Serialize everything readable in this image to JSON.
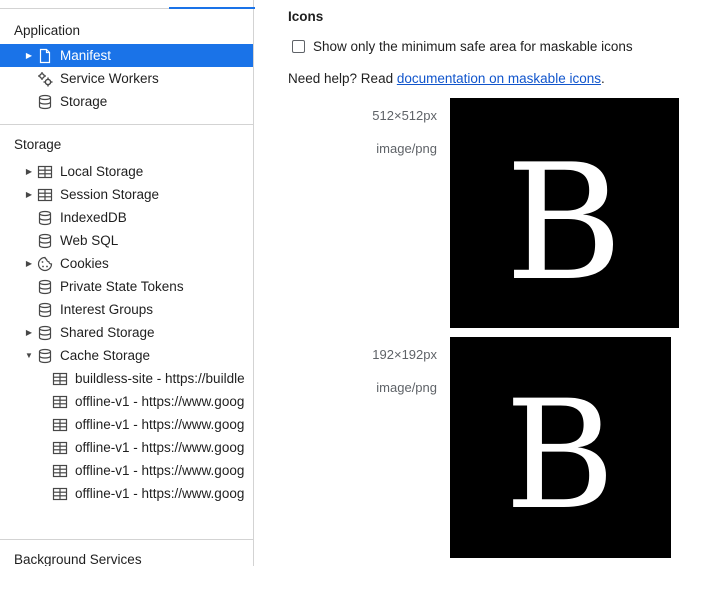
{
  "sidebar": {
    "application_header": "Application",
    "application_items": [
      {
        "label": "Manifest",
        "icon": "document-icon",
        "selected": true,
        "expandable": true
      },
      {
        "label": "Service Workers",
        "icon": "gears-icon",
        "selected": false,
        "expandable": false
      },
      {
        "label": "Storage",
        "icon": "database-icon",
        "selected": false,
        "expandable": false
      }
    ],
    "storage_header": "Storage",
    "storage_items": [
      {
        "label": "Local Storage",
        "icon": "table-icon",
        "arrow": "right"
      },
      {
        "label": "Session Storage",
        "icon": "table-icon",
        "arrow": "right"
      },
      {
        "label": "IndexedDB",
        "icon": "database-icon",
        "arrow": ""
      },
      {
        "label": "Web SQL",
        "icon": "database-icon",
        "arrow": ""
      },
      {
        "label": "Cookies",
        "icon": "cookie-icon",
        "arrow": "right"
      },
      {
        "label": "Private State Tokens",
        "icon": "database-icon",
        "arrow": ""
      },
      {
        "label": "Interest Groups",
        "icon": "database-icon",
        "arrow": ""
      },
      {
        "label": "Shared Storage",
        "icon": "database-icon",
        "arrow": "right"
      },
      {
        "label": "Cache Storage",
        "icon": "database-icon",
        "arrow": "down"
      }
    ],
    "cache_items": [
      {
        "label": "buildless-site - https://buildle",
        "icon": "table-icon"
      },
      {
        "label": "offline-v1 - https://www.goog",
        "icon": "table-icon"
      },
      {
        "label": "offline-v1 - https://www.goog",
        "icon": "table-icon"
      },
      {
        "label": "offline-v1 - https://www.goog",
        "icon": "table-icon"
      },
      {
        "label": "offline-v1 - https://www.goog",
        "icon": "table-icon"
      },
      {
        "label": "offline-v1 - https://www.goog",
        "icon": "table-icon"
      }
    ],
    "background_header": "Background Services"
  },
  "main": {
    "section_title": "Icons",
    "checkbox_label": "Show only the minimum safe area for maskable icons",
    "checkbox_checked": false,
    "help_prefix": "Need help? Read ",
    "help_link": "documentation on maskable icons",
    "help_suffix": ".",
    "icons": [
      {
        "size": "512×512px",
        "type": "image/png",
        "letter": "B"
      },
      {
        "size": "192×192px",
        "type": "image/png",
        "letter": "B"
      }
    ]
  },
  "colors": {
    "selection": "#1a73e8",
    "link": "#1155cc",
    "icon_background": "#000000",
    "icon_glyph": "#ffffff"
  }
}
